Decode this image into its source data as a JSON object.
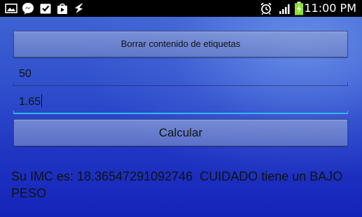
{
  "status_bar": {
    "time": "11:00 PM",
    "left_icons": [
      "picture-icon",
      "messenger-icon",
      "task-checkbox-icon",
      "shopping-bag-icon",
      "app-bolt-icon"
    ],
    "right_icons": [
      "alarm-icon",
      "signal-icon",
      "battery-charging-icon"
    ],
    "battery_color": "#8de22d"
  },
  "buttons": {
    "clear_label": "Borrar contenido de etiquetas",
    "calculate_label": "Calcular"
  },
  "inputs": {
    "weight_value": "50",
    "height_value": "1.65"
  },
  "result": {
    "text": "Su IMC es: 18.36547291092746  CUIDADO tiene un BAJO PESO"
  },
  "colors": {
    "focus_underline": "#35b6ea",
    "background_blue": "#1e34c2"
  }
}
